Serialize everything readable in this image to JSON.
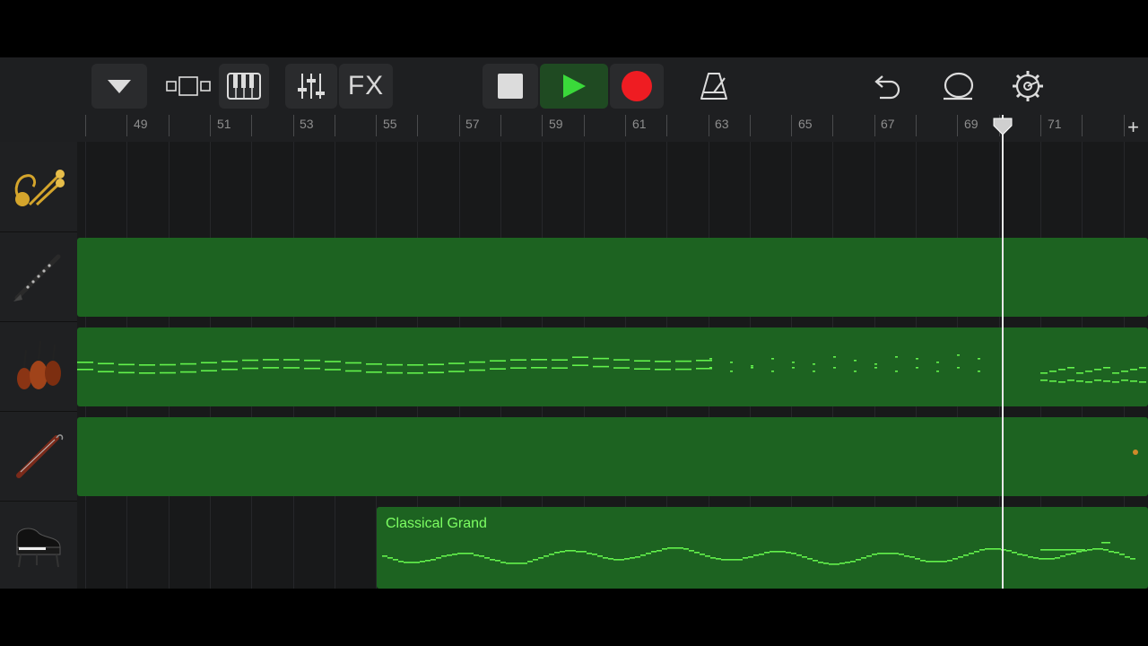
{
  "toolbar": {
    "buttons": [
      {
        "name": "track-menu-button",
        "icon": "triangle-down-icon"
      },
      {
        "name": "tracks-view-button",
        "icon": "tracks-view-icon"
      },
      {
        "name": "instrument-button",
        "icon": "keyboard-icon"
      },
      {
        "name": "mixer-button",
        "icon": "sliders-icon"
      },
      {
        "name": "fx-button",
        "label": "FX"
      },
      {
        "name": "stop-button",
        "icon": "stop-icon"
      },
      {
        "name": "play-button",
        "icon": "play-icon"
      },
      {
        "name": "record-button",
        "icon": "record-icon"
      },
      {
        "name": "metronome-button",
        "icon": "metronome-icon"
      },
      {
        "name": "undo-button",
        "icon": "undo-icon"
      },
      {
        "name": "loop-browser-button",
        "icon": "loop-icon"
      },
      {
        "name": "settings-button",
        "icon": "gear-icon"
      }
    ],
    "fx_label": "FX"
  },
  "ruler": {
    "bars": [
      "49",
      "51",
      "53",
      "55",
      "57",
      "59",
      "61",
      "63",
      "65",
      "67",
      "69",
      "71"
    ],
    "add_label": "+"
  },
  "tracks": [
    {
      "instrument": "brass-icon",
      "has_region": false
    },
    {
      "instrument": "clarinet-icon",
      "has_region": true
    },
    {
      "instrument": "strings-icon",
      "has_region": true
    },
    {
      "instrument": "bassoon-icon",
      "has_region": true
    },
    {
      "instrument": "grand-piano-icon",
      "has_region": true,
      "region_label": "Classical Grand"
    }
  ],
  "colors": {
    "region": "#1d6321",
    "notes": "#63f24c",
    "record": "#ef1c22",
    "play": "#3ad93a"
  }
}
